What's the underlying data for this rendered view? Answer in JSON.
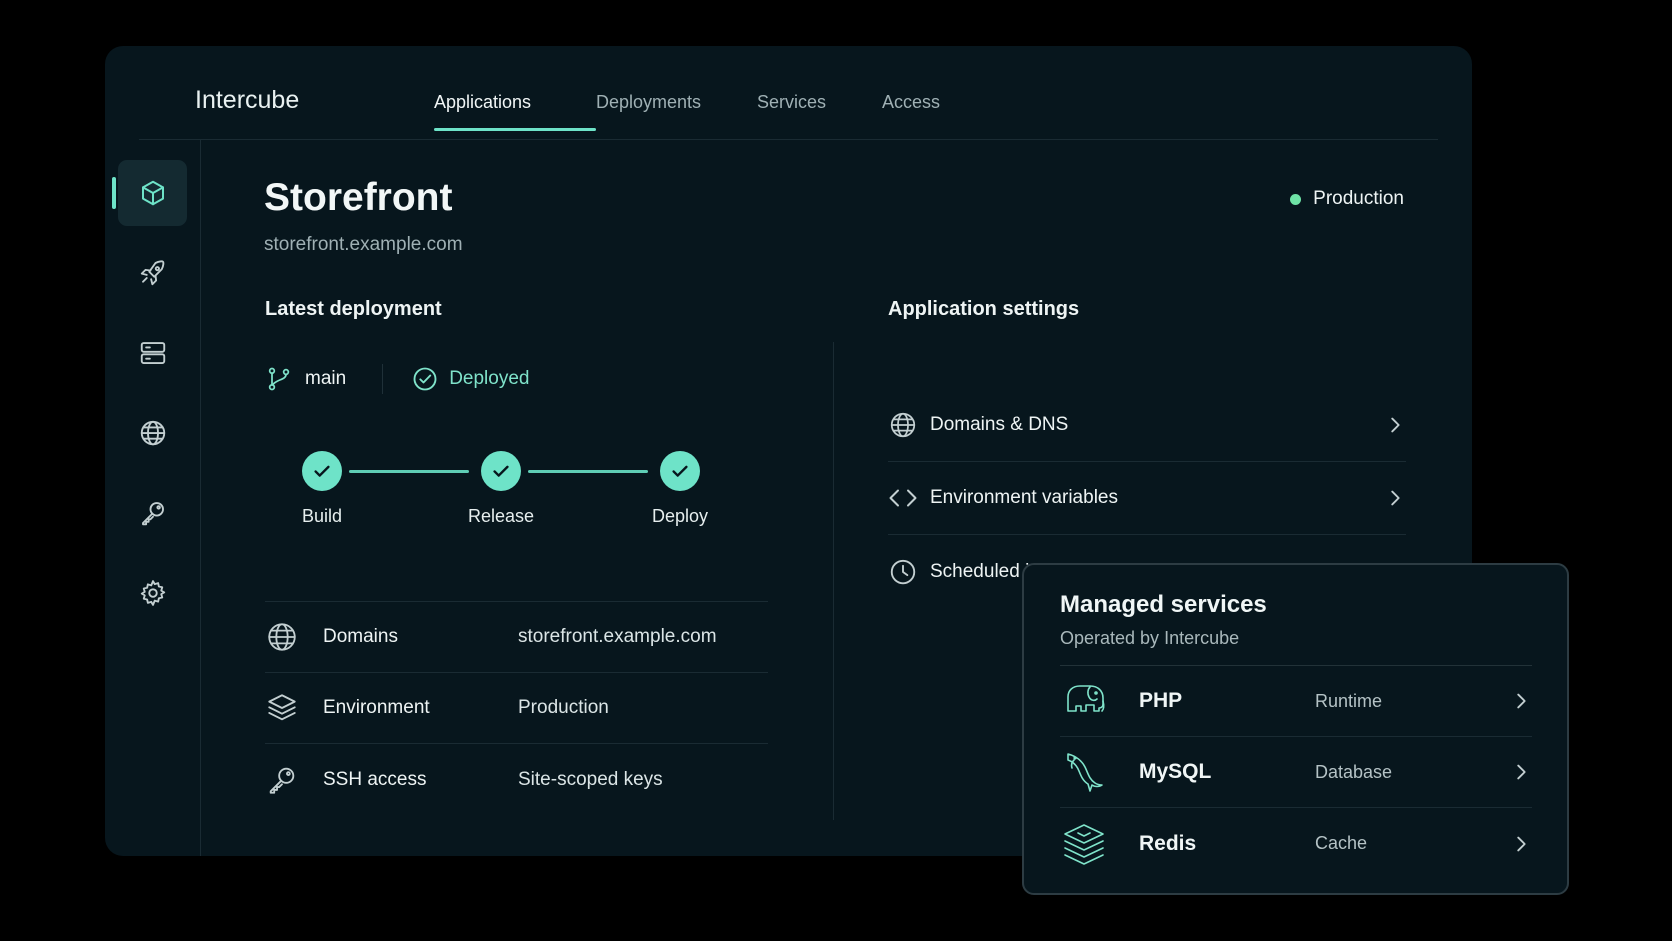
{
  "app": {
    "brand": "Intercube"
  },
  "nav": {
    "tabs": [
      {
        "label": "Applications",
        "active": true
      },
      {
        "label": "Deployments",
        "active": false
      },
      {
        "label": "Services",
        "active": false
      },
      {
        "label": "Access",
        "active": false
      }
    ]
  },
  "sidebar": {
    "items": [
      {
        "icon": "cube-icon",
        "active": true
      },
      {
        "icon": "rocket-icon",
        "active": false
      },
      {
        "icon": "server-icon",
        "active": false
      },
      {
        "icon": "globe-icon",
        "active": false
      },
      {
        "icon": "key-icon",
        "active": false
      },
      {
        "icon": "gear-icon",
        "active": false
      }
    ]
  },
  "application": {
    "name": "Storefront",
    "url": "storefront.example.com",
    "environment": "Production",
    "environment_color": "#6ee3a6"
  },
  "latest_deployment": {
    "heading": "Latest deployment",
    "branch": "main",
    "status": "Deployed",
    "steps": [
      "Build",
      "Release",
      "Deploy"
    ],
    "details": [
      {
        "icon": "globe-icon",
        "label": "Domains",
        "value": "storefront.example.com"
      },
      {
        "icon": "layers-icon",
        "label": "Environment",
        "value": "Production"
      },
      {
        "icon": "key-icon",
        "label": "SSH access",
        "value": "Site-scoped keys"
      }
    ]
  },
  "settings": {
    "heading": "Application settings",
    "items": [
      {
        "icon": "globe-icon",
        "label": "Domains & DNS"
      },
      {
        "icon": "code-icon",
        "label": "Environment variables"
      },
      {
        "icon": "clock-icon",
        "label": "Scheduled jobs"
      }
    ]
  },
  "managed_services": {
    "title": "Managed services",
    "subtitle": "Operated by Intercube",
    "items": [
      {
        "icon": "elephant-icon",
        "name": "PHP",
        "type": "Runtime"
      },
      {
        "icon": "dolphin-icon",
        "name": "MySQL",
        "type": "Database"
      },
      {
        "icon": "stack-icon",
        "name": "Redis",
        "type": "Cache"
      }
    ]
  },
  "colors": {
    "accent": "#6ee3c8",
    "background": "#07161d",
    "page": "#000000"
  }
}
